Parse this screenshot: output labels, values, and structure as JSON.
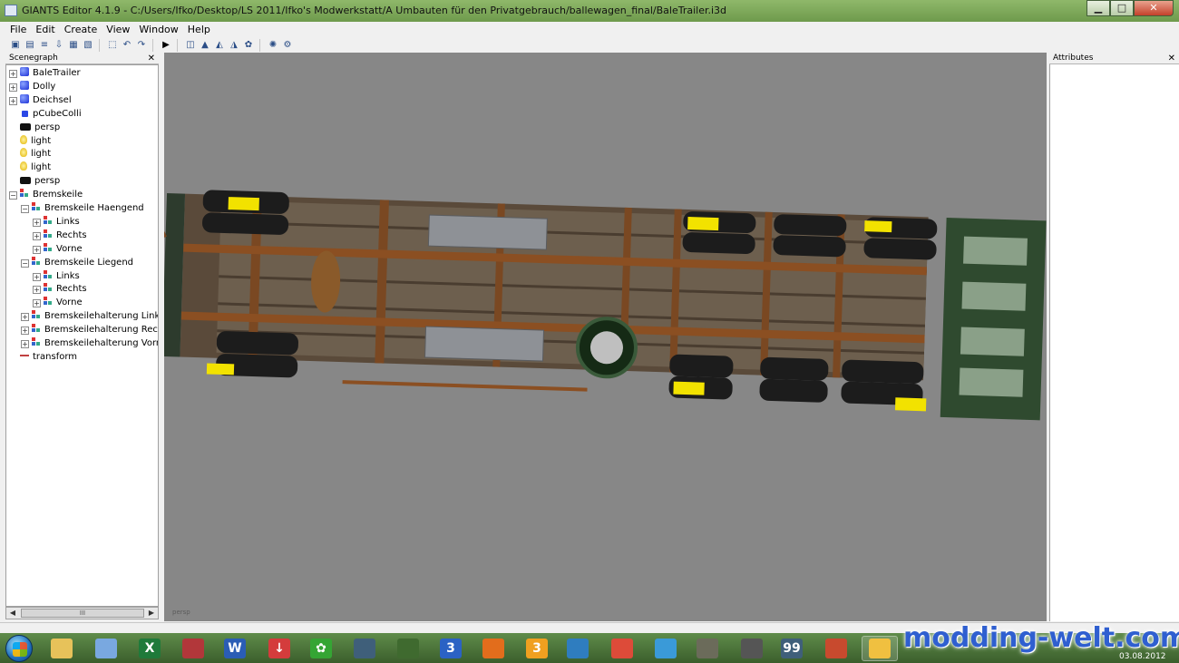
{
  "window": {
    "title": "GIANTS Editor 4.1.9 - C:/Users/Ifko/Desktop/LS 2011/Ifko's Modwerkstatt/A Umbauten für den Privatgebrauch/ballewagen_final/BaleTrailer.i3d",
    "controls": {
      "minimize": "▁",
      "maximize": "□",
      "close": "✕"
    }
  },
  "menu": [
    {
      "label": "File"
    },
    {
      "label": "Edit"
    },
    {
      "label": "Create"
    },
    {
      "label": "View"
    },
    {
      "label": "Window"
    },
    {
      "label": "Help"
    }
  ],
  "toolbar": {
    "groups": [
      [
        "new-icon",
        "open-icon",
        "list-icon",
        "import-icon",
        "save-icon",
        "save-as-icon"
      ],
      [
        "select-icon",
        "undo-icon",
        "redo-icon"
      ],
      [
        "play-icon"
      ],
      [
        "viewport-icon",
        "terrain-icon",
        "terrain-paint-icon",
        "terrain-sculpt-icon",
        "foliage-icon"
      ],
      [
        "scene-icon",
        "settings-icon"
      ]
    ]
  },
  "scenegraph": {
    "title": "Scenegraph",
    "close": "✕",
    "items": [
      {
        "label": "BaleTrailer",
        "icon": "cube",
        "depth": 0,
        "expander": "+"
      },
      {
        "label": "Dolly",
        "icon": "cube",
        "depth": 0,
        "expander": "+"
      },
      {
        "label": "Deichsel",
        "icon": "cube",
        "depth": 0,
        "expander": "+"
      },
      {
        "label": "pCubeColli",
        "icon": "cube-small",
        "depth": 0,
        "expander": ""
      },
      {
        "label": "persp",
        "icon": "camera",
        "depth": 0,
        "expander": ""
      },
      {
        "label": "light",
        "icon": "light",
        "depth": 0,
        "expander": ""
      },
      {
        "label": "light",
        "icon": "light",
        "depth": 0,
        "expander": ""
      },
      {
        "label": "light",
        "icon": "light",
        "depth": 0,
        "expander": ""
      },
      {
        "label": "persp",
        "icon": "camera",
        "depth": 0,
        "expander": ""
      },
      {
        "label": "Bremskeile",
        "icon": "transformgroup",
        "depth": 0,
        "expander": "−"
      },
      {
        "label": "Bremskeile Haengend",
        "icon": "transformgroup",
        "depth": 1,
        "expander": "−"
      },
      {
        "label": "Links",
        "icon": "transformgroup",
        "depth": 2,
        "expander": "+"
      },
      {
        "label": "Rechts",
        "icon": "transformgroup",
        "depth": 2,
        "expander": "+"
      },
      {
        "label": "Vorne",
        "icon": "transformgroup",
        "depth": 2,
        "expander": "+"
      },
      {
        "label": "Bremskeile Liegend",
        "icon": "transformgroup",
        "depth": 1,
        "expander": "−"
      },
      {
        "label": "Links",
        "icon": "transformgroup",
        "depth": 2,
        "expander": "+"
      },
      {
        "label": "Rechts",
        "icon": "transformgroup",
        "depth": 2,
        "expander": "+"
      },
      {
        "label": "Vorne",
        "icon": "transformgroup",
        "depth": 2,
        "expander": "+"
      },
      {
        "label": "Bremskeilehalterung Links",
        "icon": "transformgroup",
        "depth": 1,
        "expander": "+"
      },
      {
        "label": "Bremskeilehalterung Rechts",
        "icon": "transformgroup",
        "depth": 1,
        "expander": "+"
      },
      {
        "label": "Bremskeilehalterung Vorne",
        "icon": "transformgroup",
        "depth": 1,
        "expander": "+"
      },
      {
        "label": "transform",
        "icon": "transform",
        "depth": 0,
        "expander": ""
      }
    ],
    "scroll_thumb": "III"
  },
  "viewport": {
    "camera_label": "persp"
  },
  "attributes": {
    "title": "Attributes",
    "close": "✕"
  },
  "taskbar": {
    "apps": [
      {
        "name": "explorer",
        "glyph": "",
        "color": "#e7c25a"
      },
      {
        "name": "paint",
        "glyph": "",
        "color": "#79a8e0"
      },
      {
        "name": "excel",
        "glyph": "X",
        "color": "#1f7a3a"
      },
      {
        "name": "access",
        "glyph": "",
        "color": "#b2373a"
      },
      {
        "name": "word",
        "glyph": "W",
        "color": "#2a5db5"
      },
      {
        "name": "downloader",
        "glyph": "↓",
        "color": "#d43c3c"
      },
      {
        "name": "icq",
        "glyph": "✿",
        "color": "#35a534"
      },
      {
        "name": "teamspeak",
        "glyph": "",
        "color": "#3f5f7a"
      },
      {
        "name": "tractor",
        "glyph": "",
        "color": "#3f6a2f"
      },
      {
        "name": "app-3",
        "glyph": "3",
        "color": "#2b62c4"
      },
      {
        "name": "firefox",
        "glyph": "",
        "color": "#e26d1c"
      },
      {
        "name": "app-orange-3",
        "glyph": "3",
        "color": "#f0a020"
      },
      {
        "name": "image-viewer",
        "glyph": "",
        "color": "#2f7dbf"
      },
      {
        "name": "chrome",
        "glyph": "",
        "color": "#dd4b39"
      },
      {
        "name": "network",
        "glyph": "",
        "color": "#3a9ad8"
      },
      {
        "name": "gimp",
        "glyph": "",
        "color": "#6b6b5a"
      },
      {
        "name": "inkscape",
        "glyph": "",
        "color": "#555555"
      },
      {
        "name": "app-99",
        "glyph": "99",
        "color": "#3f5f7a"
      },
      {
        "name": "winrar",
        "glyph": "",
        "color": "#c84a2e"
      },
      {
        "name": "giants-editor",
        "glyph": "",
        "color": "#f0c040"
      }
    ],
    "date": "03.08.2012"
  },
  "watermark": "modding-welt.com"
}
